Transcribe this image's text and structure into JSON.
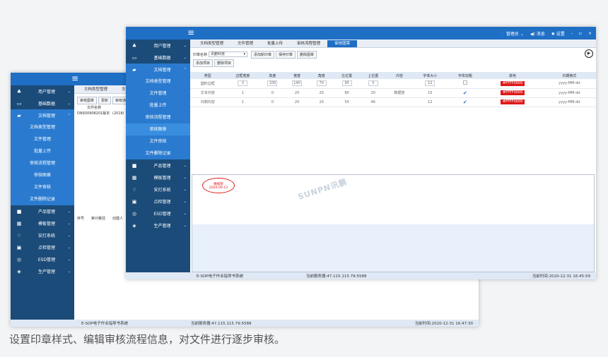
{
  "caption": "设置印章样式、编辑审核流程信息，对文件进行逐步审核。",
  "back_window": {
    "sidebar": [
      {
        "icon": "users-icon",
        "glyph": "♣",
        "label": "用户管理",
        "chevron": "⌄"
      },
      {
        "icon": "monitor-icon",
        "glyph": "▭",
        "label": "基础数据",
        "chevron": "⌄"
      },
      {
        "icon": "folder-icon",
        "glyph": "▰",
        "label": "文档管理",
        "chevron": "⌃"
      }
    ],
    "submenu": [
      "文档类型管理",
      "文件管理",
      "批量上传",
      "审核流程管理",
      "审核图章",
      "文件审核",
      "文件删除记录"
    ],
    "sidebar_after": [
      {
        "icon": "box-icon",
        "glyph": "■",
        "label": "产品管理",
        "chevron": "⌄"
      },
      {
        "icon": "template-icon",
        "glyph": "▦",
        "label": "模板管理",
        "chevron": "⌄"
      },
      {
        "icon": "bell-icon",
        "glyph": "♢",
        "label": "安灯系统",
        "chevron": "⌄"
      },
      {
        "icon": "checklist-icon",
        "glyph": "▣",
        "label": "点检管理",
        "chevron": "⌄"
      },
      {
        "icon": "esd-icon",
        "glyph": "◎",
        "label": "ESD管理",
        "chevron": "⌄"
      },
      {
        "icon": "layers-icon",
        "glyph": "◈",
        "label": "生产管理",
        "chevron": "⌄"
      }
    ],
    "tabs": [
      "文档类型管理",
      "文件"
    ],
    "toolbar_buttons": [
      "审核图章",
      "更新",
      "审核通过"
    ],
    "table_header": "文件名称",
    "table_row": [
      "DN930908201版本",
      "(2018/"
    ],
    "lower_headers": [
      "序号",
      "审计路径",
      "创建人"
    ],
    "status": {
      "system": "E-SOP电子作业指导书系统",
      "server": "当前服务器:47.115.115.79:5588",
      "time": "当前时间:2020-12-31 16:47:30"
    }
  },
  "front_window": {
    "top": {
      "user": "管理员",
      "message": "消息",
      "settings": "设置",
      "minimize": "-",
      "maximize": "▫",
      "close": "×"
    },
    "sidebar": [
      {
        "icon": "users-icon",
        "glyph": "♣",
        "label": "用户管理",
        "chevron": "⌄"
      },
      {
        "icon": "monitor-icon",
        "glyph": "▭",
        "label": "基础数据",
        "chevron": "⌄"
      },
      {
        "icon": "folder-icon",
        "glyph": "▰",
        "label": "文档管理",
        "chevron": "⌃"
      }
    ],
    "submenu": [
      "文档类型管理",
      "文件管理",
      "批量上传",
      "审核流程管理",
      "审核图章",
      "文件审核",
      "文件删除记录"
    ],
    "sidebar_after": [
      {
        "icon": "box-icon",
        "glyph": "■",
        "label": "产品管理",
        "chevron": "⌄"
      },
      {
        "icon": "template-icon",
        "glyph": "▦",
        "label": "模板管理",
        "chevron": "⌄"
      },
      {
        "icon": "bell-icon",
        "glyph": "♢",
        "label": "安灯系统",
        "chevron": "⌄"
      },
      {
        "icon": "checklist-icon",
        "glyph": "▣",
        "label": "点检管理",
        "chevron": "⌄"
      },
      {
        "icon": "esd-icon",
        "glyph": "◎",
        "label": "ESD管理",
        "chevron": "⌄"
      },
      {
        "icon": "layers-icon",
        "glyph": "◈",
        "label": "生产管理",
        "chevron": "⌄"
      }
    ],
    "tabs": [
      "文档类型管理",
      "文件管理",
      "批量上传",
      "审核流程管理",
      "审核图章"
    ],
    "toolbar": {
      "stamp_label": "印章名称",
      "stamp_value": "讯鹏科技",
      "buttons_row1": [
        "添加新印章",
        "保存印章",
        "删除图章"
      ],
      "buttons_row2": [
        "添加项目",
        "删除项目"
      ],
      "play": "▶"
    },
    "columns": [
      "类型",
      "边框宽度",
      "高度",
      "宽度",
      "角度",
      "左位置",
      "上位置",
      "内容",
      "字体大小",
      "字体加粗",
      "颜色",
      "日期格式"
    ],
    "rows": [
      {
        "type": "圆形边框",
        "border": "3",
        "height": "100",
        "width": "140",
        "angle": "70",
        "left": "95",
        "top": "5",
        "content": "",
        "font": "12",
        "bold": false,
        "color": "#FFFF0000",
        "date": "yyyy-MM-dd"
      },
      {
        "type": "文本内容",
        "border": "1",
        "height": "0",
        "width": "20",
        "angle": "20",
        "left": "80",
        "top": "20",
        "content": "数据管",
        "font": "15",
        "bold": true,
        "color": "#FFFF0000",
        "date": "yyyy-MM-dd"
      },
      {
        "type": "日期内容",
        "border": "1",
        "height": "0",
        "width": "20",
        "angle": "20",
        "left": "50",
        "top": "46",
        "content": "",
        "font": "12",
        "bold": true,
        "color": "#FFFF0000",
        "date": "yyyy-MM-dd"
      }
    ],
    "stamp_preview": {
      "text": "数据管",
      "date": "2020-09-13"
    },
    "watermark": "SUNPN讯鹏",
    "status": {
      "system": "E-SOP电子作业指导书系统",
      "server": "当前服务器:47.115.115.79:5588",
      "time": "当前时间:2020-12-31 16:45:59"
    }
  }
}
